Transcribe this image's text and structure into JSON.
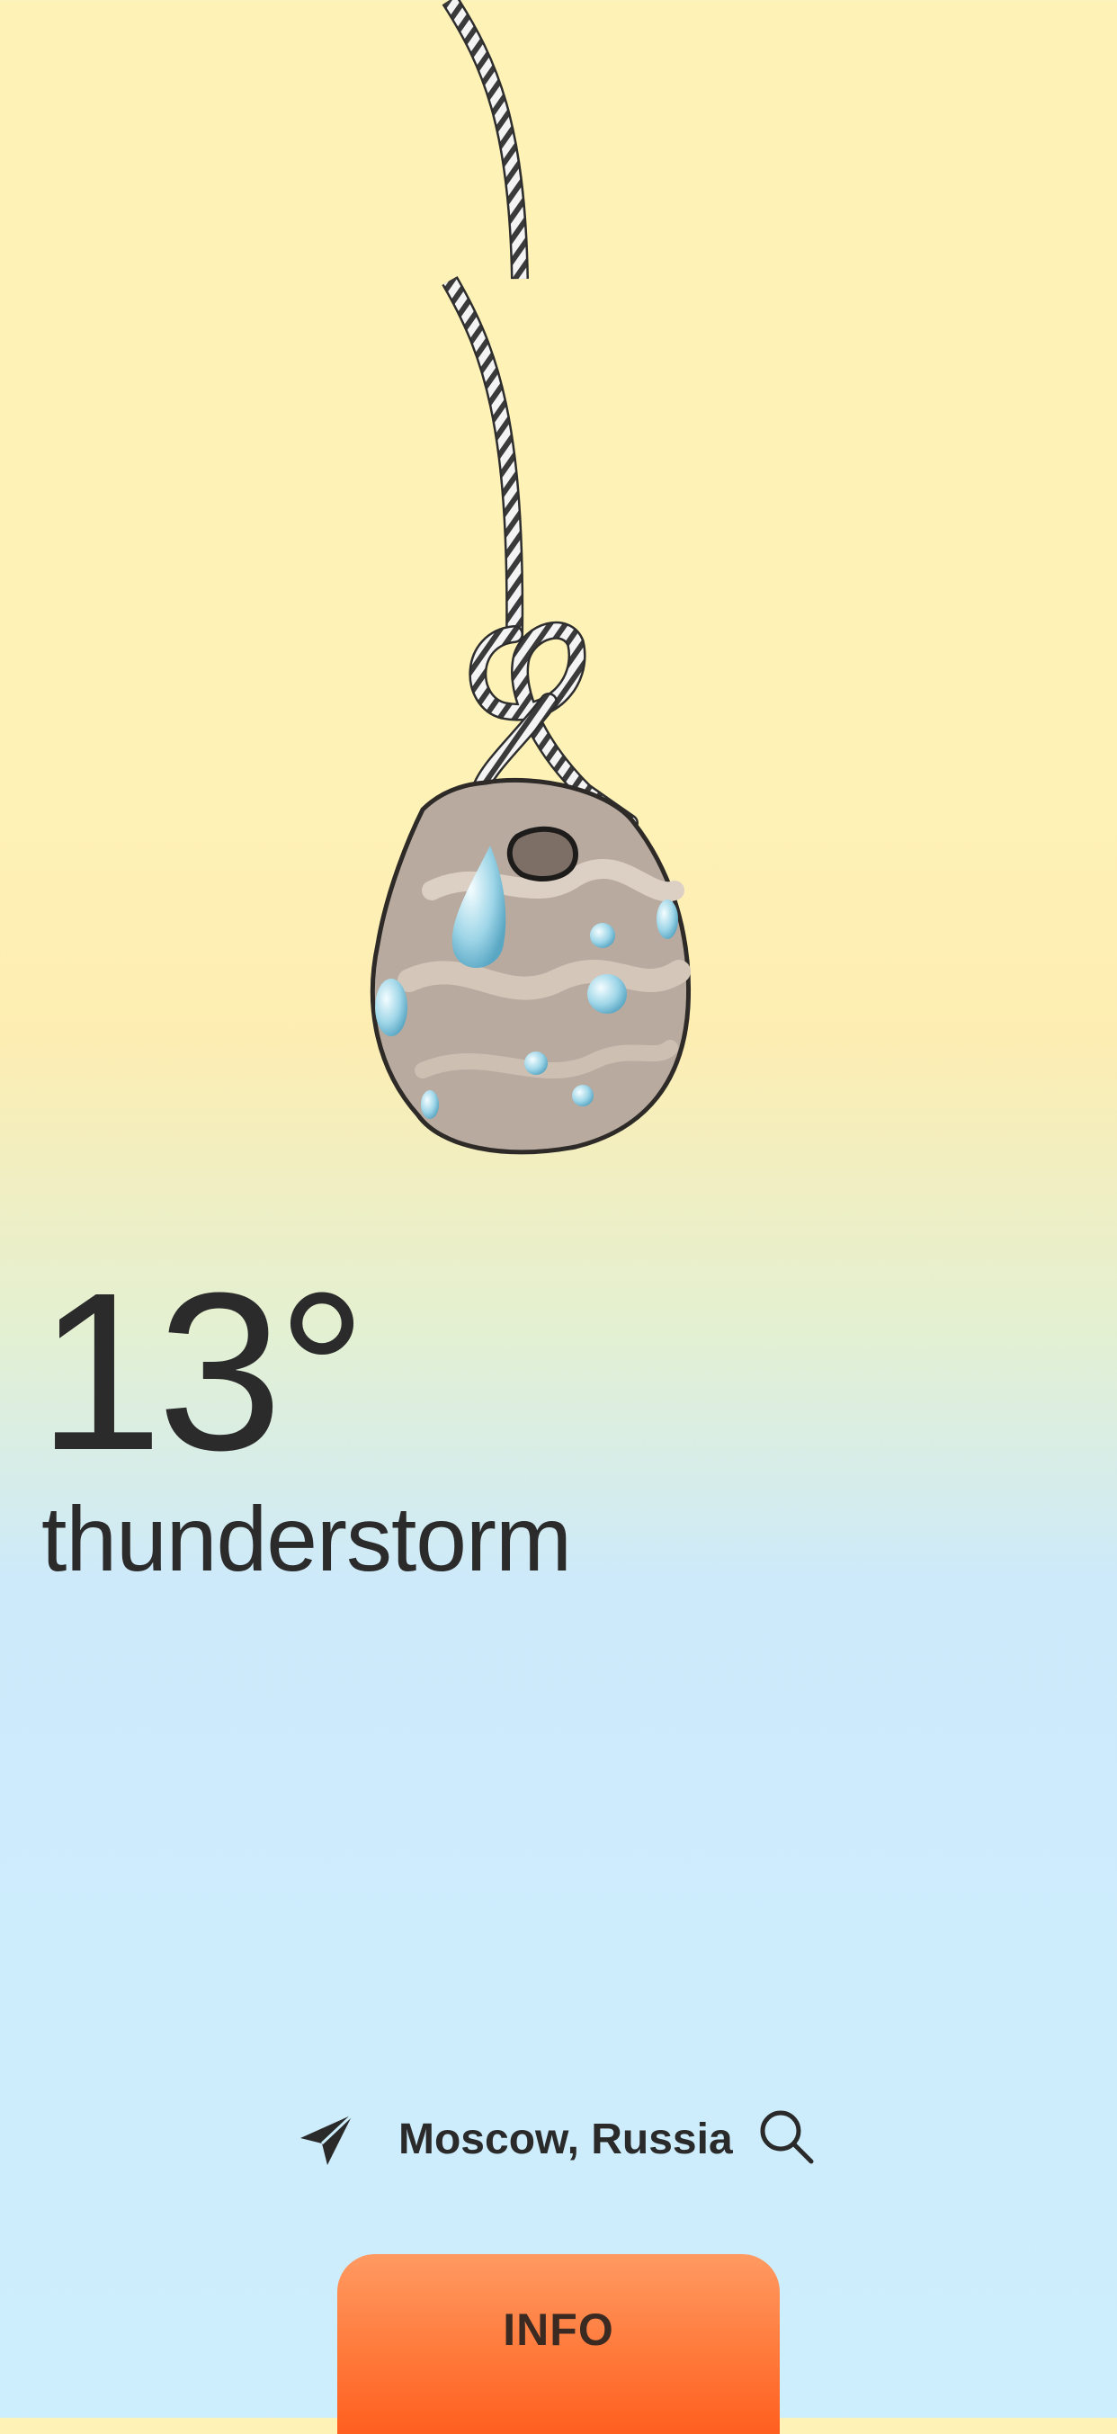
{
  "weather": {
    "temperature": "13°",
    "condition": "thunderstorm"
  },
  "location": {
    "label": "Moscow, Russia",
    "location_icon": "location-arrow-icon",
    "search_icon": "search-icon"
  },
  "info_button": {
    "label": "INFO",
    "color": "#ff7a3b"
  },
  "stone": {
    "icon": "hanging-stone-icon",
    "state": "wet"
  },
  "colors": {
    "sky_top": "#fff2b6",
    "sky_bottom": "#cdeefd",
    "text": "#2b2b2b"
  }
}
